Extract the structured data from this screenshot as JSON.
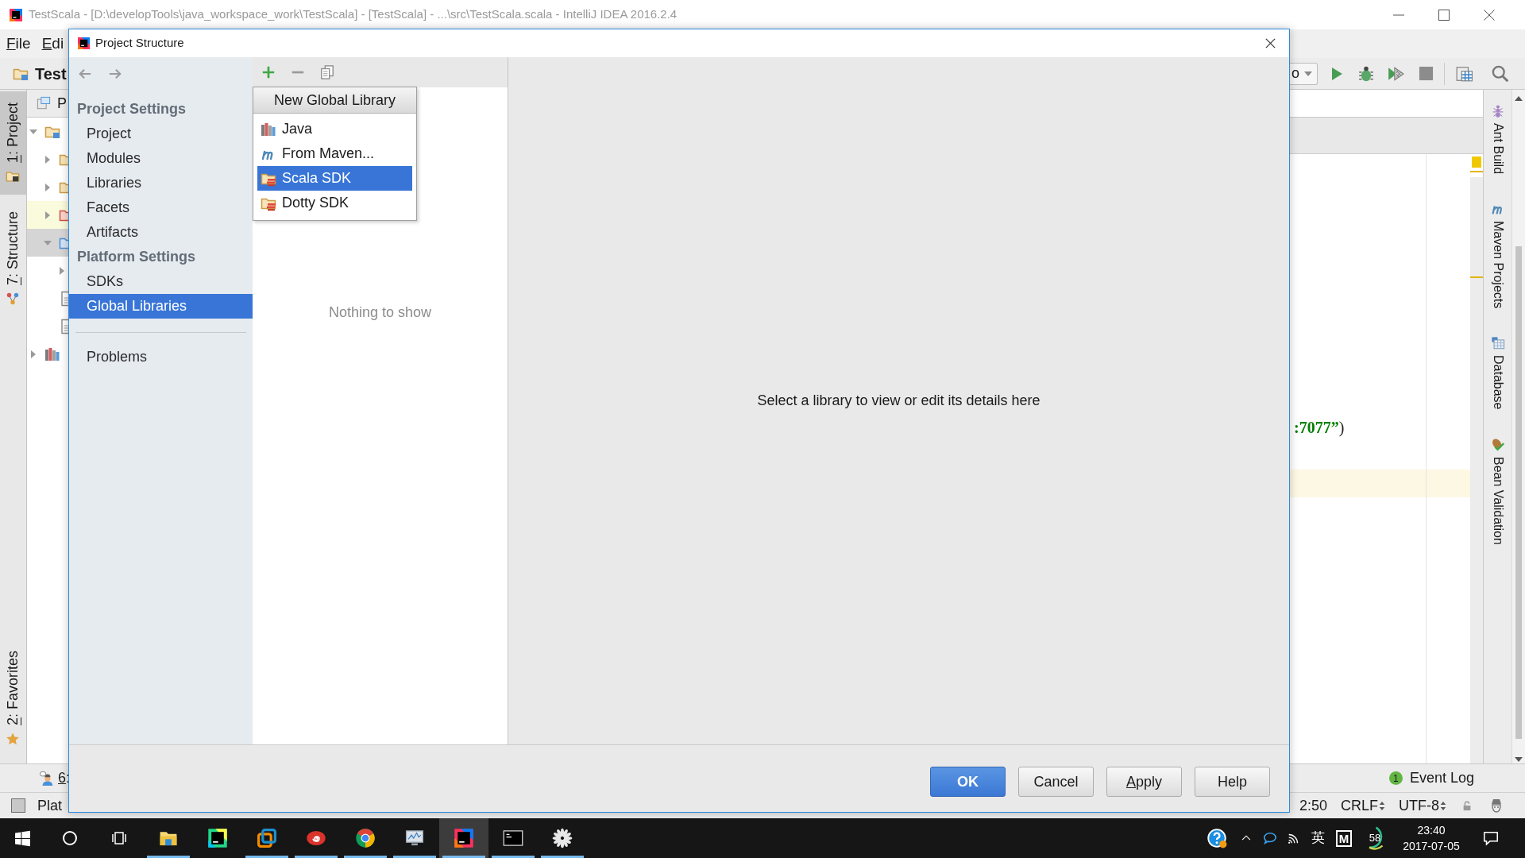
{
  "ide_window": {
    "title": "TestScala - [D:\\developTools\\java_workspace_work\\TestScala] - [TestScala] - ...\\src\\TestScala.scala - IntelliJ IDEA 2016.2.4",
    "menu": [
      {
        "label": "File"
      },
      {
        "label": "Edi"
      }
    ],
    "toolbar": {
      "project_label": "Test",
      "run_config": "o"
    },
    "left_tool_windows": [
      {
        "label": "1: Project",
        "selected": true
      },
      {
        "label": "7: Structure",
        "selected": false
      },
      {
        "label": "2: Favorites",
        "selected": false
      }
    ],
    "project_panel": {
      "header": "P",
      "tree": [
        {
          "kind": "project-folder",
          "expanded": true,
          "selected": false,
          "children": [
            {
              "kind": "folder",
              "expanded": false,
              "selected": false
            },
            {
              "kind": "folder",
              "expanded": false,
              "selected": false
            },
            {
              "kind": "excluded-folder",
              "expanded": false,
              "selected": false
            },
            {
              "kind": "source-folder",
              "expanded": true,
              "selected": true,
              "children": [
                {
                  "expanded": false,
                  "selected": false
                }
              ]
            },
            {
              "kind": "file",
              "selected": false
            },
            {
              "kind": "file",
              "selected": false
            }
          ]
        },
        {
          "kind": "libraries",
          "expanded": false,
          "selected": false
        }
      ]
    },
    "editor": {
      "code": [
        {
          "kind": "string",
          "text": ":7077”"
        },
        {
          "kind": "plain",
          "text": ")"
        }
      ]
    },
    "right_tool_windows": [
      {
        "label": "Ant Build"
      },
      {
        "label": "Maven Projects"
      },
      {
        "label": "Database"
      },
      {
        "label": "Bean Validation"
      }
    ],
    "bottom_tool_windows": [
      {
        "label": "6:"
      },
      {
        "label": "Event Log",
        "badge": "1"
      }
    ],
    "status_bar": {
      "message": "Plat",
      "items": [
        {
          "text": "2:50",
          "dropdown": false
        },
        {
          "text": "CRLF",
          "dropdown": true
        },
        {
          "text": "UTF-8",
          "dropdown": true
        }
      ]
    }
  },
  "dialog": {
    "title": "Project Structure",
    "sidebar": {
      "sections": [
        {
          "heading": "Project Settings",
          "items": [
            {
              "label": "Project",
              "selected": false
            },
            {
              "label": "Modules",
              "selected": false
            },
            {
              "label": "Libraries",
              "selected": false
            },
            {
              "label": "Facets",
              "selected": false
            },
            {
              "label": "Artifacts",
              "selected": false
            }
          ]
        },
        {
          "heading": "Platform Settings",
          "items": [
            {
              "label": "SDKs",
              "selected": false
            },
            {
              "label": "Global Libraries",
              "selected": true
            }
          ]
        },
        {
          "items": [
            {
              "label": "Problems",
              "selected": false
            }
          ]
        }
      ]
    },
    "list_panel": {
      "empty_text": "Nothing to show"
    },
    "add_menu": {
      "title": "New Global Library",
      "items": [
        {
          "label": "Java",
          "selected": false
        },
        {
          "label": "From Maven...",
          "selected": false
        },
        {
          "label": "Scala SDK",
          "selected": true
        },
        {
          "label": "Dotty SDK",
          "selected": false
        }
      ]
    },
    "details_text": "Select a library to view or edit its details here",
    "buttons": [
      {
        "label": "OK",
        "kind": "default",
        "mnemonic": false
      },
      {
        "label": "Cancel",
        "kind": "normal",
        "mnemonic": false
      },
      {
        "label": "Apply",
        "kind": "normal",
        "mnemonic": true
      },
      {
        "label": "Help",
        "kind": "normal",
        "mnemonic": false
      }
    ]
  },
  "taskbar": {
    "apps": [
      {
        "running": true,
        "selected": false
      },
      {
        "running": false,
        "selected": false
      },
      {
        "running": true,
        "selected": false
      },
      {
        "running": true,
        "selected": false
      },
      {
        "running": true,
        "selected": false
      },
      {
        "running": true,
        "selected": false
      },
      {
        "running": true,
        "selected": true
      },
      {
        "running": true,
        "selected": false
      },
      {
        "running": true,
        "selected": false
      }
    ],
    "tray": {
      "ime": "英",
      "app_letter": "M",
      "gauge_reading": "58",
      "time": "23:40",
      "date": "2017-07-05"
    }
  }
}
